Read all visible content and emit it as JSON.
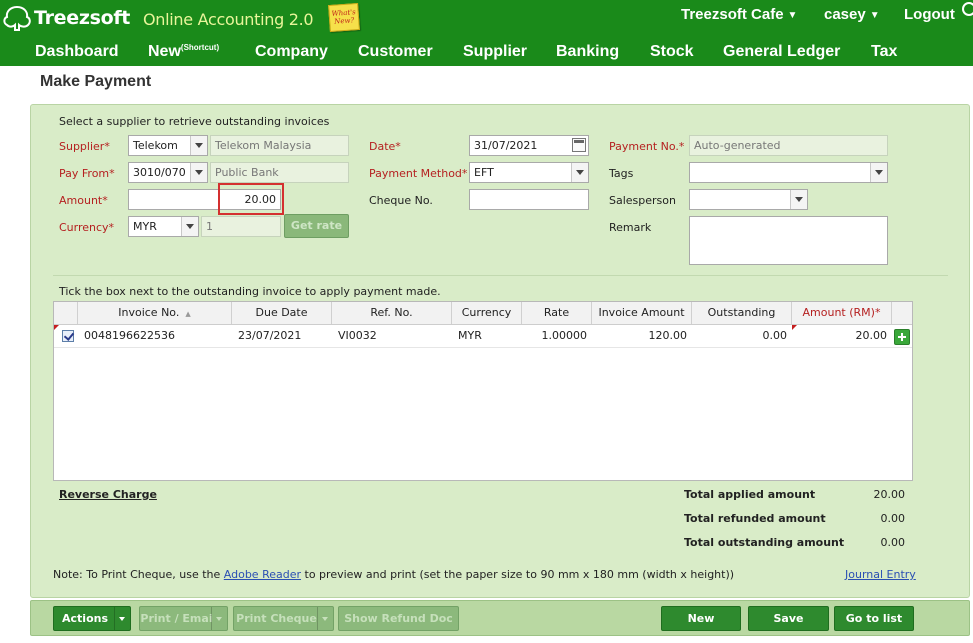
{
  "header": {
    "logo_text": "Treezsoft",
    "app_name": "Online Accounting 2.0",
    "whats_new": "What's New?",
    "company": "Treezsoft Cafe",
    "user": "casey",
    "logout": "Logout"
  },
  "nav": {
    "dashboard": "Dashboard",
    "new": "New",
    "new_sup": "(Shortcut)",
    "company": "Company",
    "customer": "Customer",
    "supplier": "Supplier",
    "banking": "Banking",
    "stock": "Stock",
    "general_ledger": "General Ledger",
    "tax": "Tax"
  },
  "page": {
    "title": "Make Payment"
  },
  "form": {
    "instruction": "Select a supplier to retrieve outstanding invoices",
    "supplier_label": "Supplier*",
    "supplier_code": "Telekom",
    "supplier_name": "Telekom Malaysia",
    "pay_from_label": "Pay From*",
    "pay_from_code": "3010/070",
    "pay_from_name": "Public Bank",
    "amount_label": "Amount*",
    "amount_value": "20.00",
    "currency_label": "Currency*",
    "currency_value": "MYR",
    "rate_value": "1",
    "get_rate": "Get rate",
    "date_label": "Date*",
    "date_value": "31/07/2021",
    "payment_method_label": "Payment Method*",
    "payment_method_value": "EFT",
    "cheque_label": "Cheque No.",
    "cheque_value": "",
    "payment_no_label": "Payment No.*",
    "payment_no_value": "Auto-generated",
    "tags_label": "Tags",
    "salesperson_label": "Salesperson",
    "remark_label": "Remark"
  },
  "table": {
    "instruction": "Tick the box next to the outstanding invoice to apply payment made.",
    "columns": {
      "invoice_no": "Invoice No.",
      "due_date": "Due Date",
      "ref_no": "Ref. No.",
      "currency": "Currency",
      "rate": "Rate",
      "invoice_amount": "Invoice Amount",
      "outstanding": "Outstanding",
      "amount_rm": "Amount (RM)*"
    },
    "rows": [
      {
        "checked": true,
        "invoice_no": "0048196622536",
        "due_date": "23/07/2021",
        "ref_no": "VI0032",
        "currency": "MYR",
        "rate": "1.00000",
        "invoice_amount": "120.00",
        "outstanding": "0.00",
        "amount_rm": "20.00"
      }
    ]
  },
  "totals": {
    "reverse_charge": "Reverse Charge",
    "applied_label": "Total applied amount",
    "applied_value": "20.00",
    "refunded_label": "Total refunded amount",
    "refunded_value": "0.00",
    "outstanding_label": "Total outstanding amount",
    "outstanding_value": "0.00"
  },
  "note": {
    "prefix": "Note: To Print Cheque, use the ",
    "link": "Adobe Reader",
    "suffix": " to preview and print (set the paper size to 90 mm x 180 mm (width x height))",
    "journal_entry": "Journal Entry"
  },
  "toolbar": {
    "actions": "Actions",
    "print_email": "Print / Emai",
    "print_cheque": "Print Cheque",
    "show_refund_doc": "Show Refund Doc",
    "new": "New",
    "save": "Save",
    "go_to_list": "Go to list"
  },
  "colors": {
    "header_green": "#1a8a1a",
    "panel_green": "#d9ecc8",
    "required_red": "#b52020",
    "button_green": "#2e8a2e"
  }
}
